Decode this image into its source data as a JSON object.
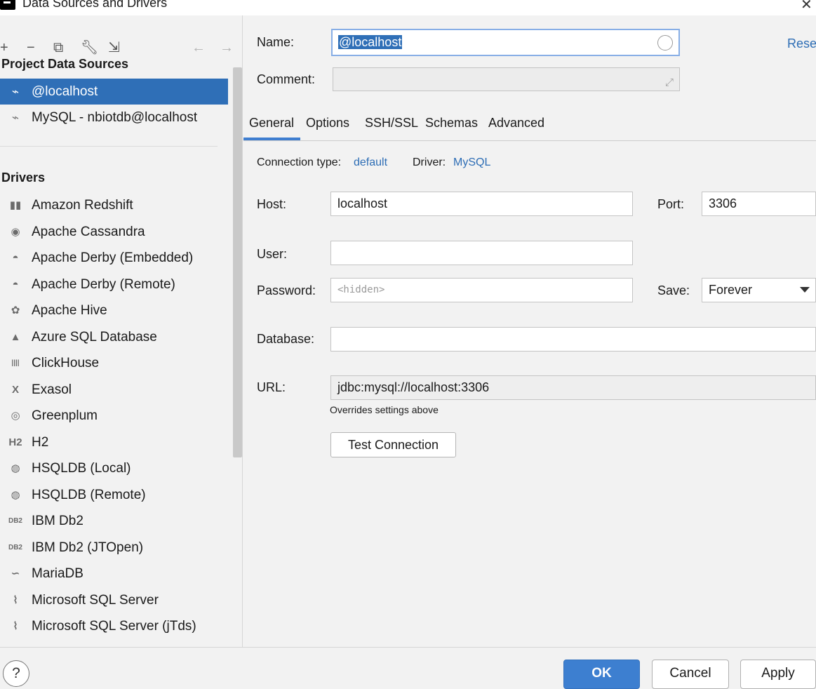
{
  "window": {
    "title": "Data Sources and Drivers"
  },
  "toolbar": {
    "add": "+",
    "remove": "−",
    "duplicate": "⧉",
    "properties": "🔧",
    "import": "⇲",
    "back": "←",
    "forward": "→"
  },
  "project_sources": {
    "title": "Project Data Sources",
    "items": [
      {
        "label": "@localhost",
        "selected": true,
        "icon": "dolphin-icon"
      },
      {
        "label": "MySQL - nbiotdb@localhost",
        "selected": false,
        "icon": "dolphin-icon"
      }
    ]
  },
  "drivers": {
    "title": "Drivers",
    "items": [
      {
        "label": "Amazon Redshift",
        "icon": "redshift-icon",
        "glyph": "▮▮"
      },
      {
        "label": "Apache Cassandra",
        "icon": "cassandra-eye-icon",
        "glyph": "◉"
      },
      {
        "label": "Apache Derby (Embedded)",
        "icon": "derby-hat-icon",
        "glyph": "◓"
      },
      {
        "label": "Apache Derby (Remote)",
        "icon": "derby-hat-icon",
        "glyph": "◓"
      },
      {
        "label": "Apache Hive",
        "icon": "hive-bee-icon",
        "glyph": "✿"
      },
      {
        "label": "Azure SQL Database",
        "icon": "azure-icon",
        "glyph": "▲"
      },
      {
        "label": "ClickHouse",
        "icon": "clickhouse-icon",
        "glyph": "||||"
      },
      {
        "label": "Exasol",
        "icon": "exasol-x-icon",
        "glyph": "X"
      },
      {
        "label": "Greenplum",
        "icon": "greenplum-icon",
        "glyph": "◎"
      },
      {
        "label": "H2",
        "icon": "h2-icon",
        "glyph": "H2"
      },
      {
        "label": "HSQLDB (Local)",
        "icon": "hsqldb-icon",
        "glyph": "◍"
      },
      {
        "label": "HSQLDB (Remote)",
        "icon": "hsqldb-icon",
        "glyph": "◍"
      },
      {
        "label": "IBM Db2",
        "icon": "ibm-db2-icon",
        "glyph": "DB2"
      },
      {
        "label": "IBM Db2 (JTOpen)",
        "icon": "ibm-db2-icon",
        "glyph": "DB2"
      },
      {
        "label": "MariaDB",
        "icon": "mariadb-seal-icon",
        "glyph": "∽"
      },
      {
        "label": "Microsoft SQL Server",
        "icon": "sql-server-icon",
        "glyph": "⌇"
      },
      {
        "label": "Microsoft SQL Server (jTds)",
        "icon": "sql-server-icon",
        "glyph": "⌇"
      }
    ]
  },
  "form": {
    "name_label": "Name:",
    "name_value": "@localhost",
    "comment_label": "Comment:",
    "comment_value": "",
    "reset_label": "Reset",
    "tabs": [
      "General",
      "Options",
      "SSH/SSL",
      "Schemas",
      "Advanced"
    ],
    "active_tab": "General",
    "connection_type_label": "Connection type:",
    "connection_type_value": "default",
    "driver_label": "Driver:",
    "driver_value": "MySQL",
    "host_label": "Host:",
    "host_value": "localhost",
    "port_label": "Port:",
    "port_value": "3306",
    "user_label": "User:",
    "user_value": "",
    "password_label": "Password:",
    "password_placeholder": "<hidden>",
    "save_label": "Save:",
    "save_value": "Forever",
    "database_label": "Database:",
    "database_value": "",
    "url_label": "URL:",
    "url_value": "jdbc:mysql://localhost:3306",
    "url_hint": "Overrides settings above",
    "test_connection_label": "Test Connection"
  },
  "footer": {
    "help": "?",
    "ok": "OK",
    "cancel": "Cancel",
    "apply": "Apply"
  },
  "colors": {
    "selection": "#2f6fb7",
    "link": "#2d6db5",
    "primary_button": "#3d7fd0",
    "tab_underline": "#3f7ed0"
  }
}
